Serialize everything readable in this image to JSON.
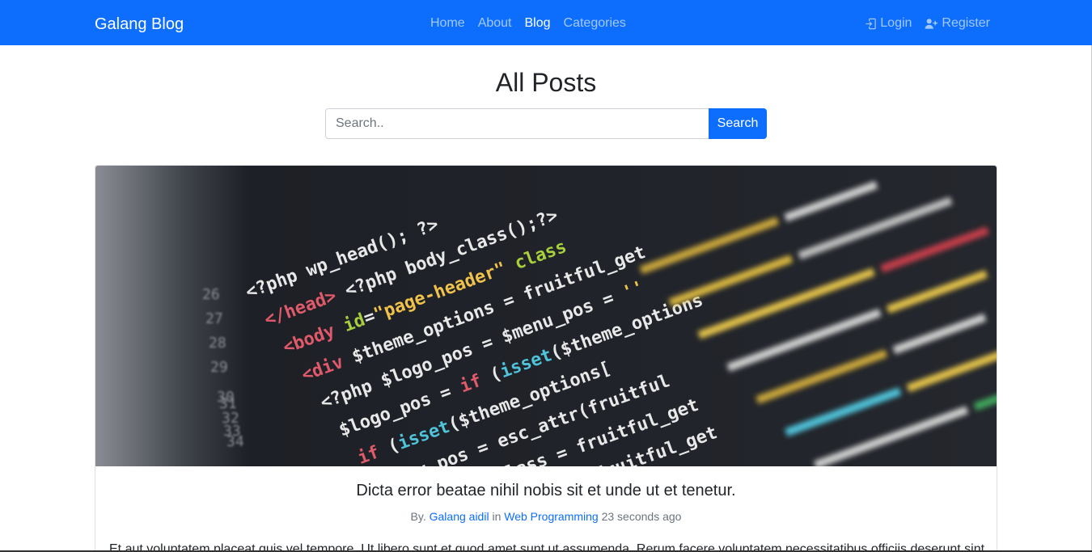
{
  "colors": {
    "primary": "#0d6efd",
    "text": "#212529",
    "muted": "#6c757d"
  },
  "navbar": {
    "brand": "Galang Blog",
    "links": [
      {
        "label": "Home",
        "active": false
      },
      {
        "label": "About",
        "active": false
      },
      {
        "label": "Blog",
        "active": true
      },
      {
        "label": "Categories",
        "active": false
      }
    ],
    "auth": [
      {
        "label": "Login",
        "icon": "login-icon"
      },
      {
        "label": "Register",
        "icon": "person-plus-icon"
      }
    ]
  },
  "page": {
    "title": "All Posts"
  },
  "search": {
    "placeholder": "Search..",
    "button_label": "Search"
  },
  "post": {
    "image": "code-screenshot",
    "title": "Dicta error beatae nihil nobis sit et unde ut et tenetur.",
    "by_label": "By.",
    "author": "Galang aidil",
    "in_label": "in",
    "category": "Web Programming",
    "time": "23 seconds ago",
    "excerpt": "Et aut voluptatem placeat quis vel tempore. Ut libero sunt et quod amet sunt ut assumenda. Rerum facere voluptatem necessitatibus officiis deserunt sint."
  }
}
